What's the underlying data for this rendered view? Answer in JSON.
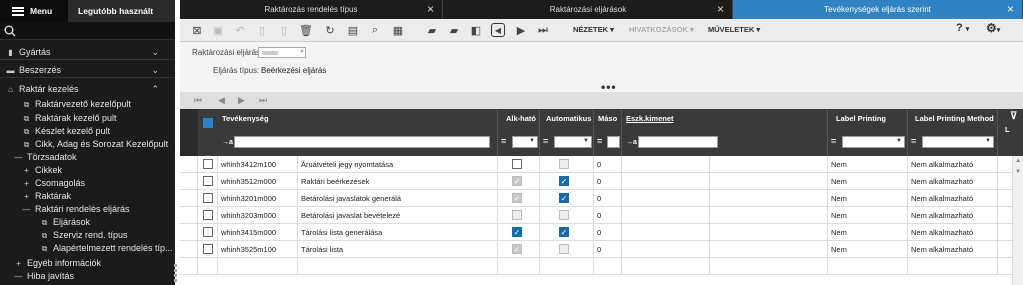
{
  "sidebar": {
    "menu_label": "Menu",
    "recent_label": "Legutóbb használt",
    "sections": [
      {
        "label": "Gyártás",
        "icon": "chart-icon"
      },
      {
        "label": "Beszerzés",
        "icon": "truck-icon"
      },
      {
        "label": "Raktár kezelés",
        "icon": "warehouse-icon"
      }
    ],
    "items": [
      "Raktárvezető kezelőpult",
      "Raktárak kezelő pult",
      "Készlet kezelő pult",
      "Cikk, Adag és Sorozat Kezelőpult",
      "Törzsadatok",
      "Cikkek",
      "Csomagolás",
      "Raktárak",
      "Raktári rendelés eljárás",
      "Eljárások",
      "Szerviz rend. típus",
      "Alapértelmezett rendelés típ...",
      "Egyéb információk",
      "Hiba javítás"
    ]
  },
  "tabs": [
    {
      "label": "Raktározás rendelés típus"
    },
    {
      "label": "Raktározási eljárások"
    },
    {
      "label": "Tevékenységek eljárás szerint"
    }
  ],
  "toolbar": {
    "menus": [
      "NÉZETEK",
      "HIVATKOZÁSOK",
      "MŰVELETEK"
    ],
    "help": "?"
  },
  "form": {
    "field1_label": "Raktározási eljárás:",
    "field2_label": "Eljárás típus:",
    "field2_value": "Beérkezési eljárás"
  },
  "grid": {
    "columns": [
      "Tevékenység",
      "Alk-ható",
      "Automatikus",
      "Máso",
      "Eszk.kimenet",
      "Label Printing",
      "Label Printing Method",
      "L"
    ],
    "filter_prefix": "→a",
    "rows": [
      {
        "code": "whinh3412m100",
        "desc": "Áruátvételi jegy nyomtatása",
        "alk": false,
        "alk_dis": false,
        "auto": false,
        "auto_dis": true,
        "maso": "0",
        "lp": "Nem",
        "lpm": "Nem alkalmazható"
      },
      {
        "code": "whinh3512m000",
        "desc": "Raktári beérkezések",
        "alk": true,
        "alk_dis": true,
        "auto": true,
        "auto_dis": false,
        "maso": "0",
        "lp": "Nem",
        "lpm": "Nem alkalmazható"
      },
      {
        "code": "whinh3201m000",
        "desc": "Betárolási javaslatok generálá",
        "alk": true,
        "alk_dis": true,
        "auto": true,
        "auto_dis": false,
        "maso": "0",
        "lp": "Nem",
        "lpm": "Nem alkalmazható"
      },
      {
        "code": "whinh3203m000",
        "desc": "Betárolási javaslat bevételezé",
        "alk": false,
        "alk_dis": true,
        "auto": false,
        "auto_dis": true,
        "maso": "0",
        "lp": "Nem",
        "lpm": "Nem alkalmazható"
      },
      {
        "code": "whinh3415m000",
        "desc": "Tárolási lista generálása",
        "alk": true,
        "alk_dis": false,
        "auto": true,
        "auto_dis": false,
        "maso": "0",
        "lp": "Nem",
        "lpm": "Nem alkalmazható"
      },
      {
        "code": "whinh3525m100",
        "desc": "Tárolási lista",
        "alk": true,
        "alk_dis": true,
        "auto": false,
        "auto_dis": true,
        "maso": "0",
        "lp": "Nem",
        "lpm": "Nem alkalmazható"
      }
    ]
  },
  "colors": {
    "accent": "#2f82c4",
    "header": "#3a3a3a",
    "sidebar": "#1b1b1b"
  }
}
